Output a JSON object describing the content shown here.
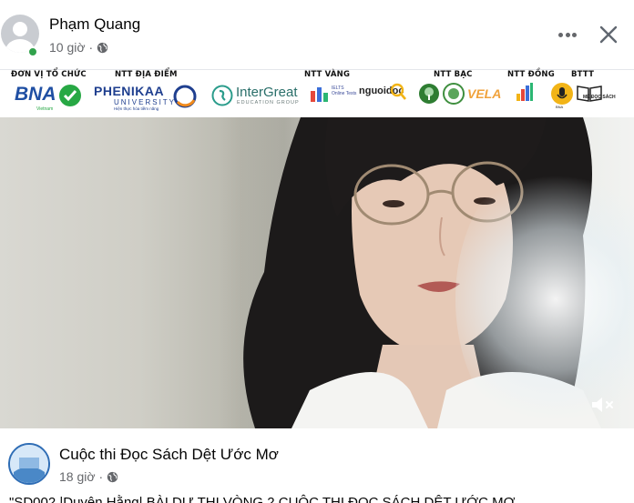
{
  "post": {
    "author": "Phạm Quang",
    "time": "10 giờ",
    "separator": "·",
    "privacy_icon": "globe-icon",
    "actions": {
      "more_icon": "more-horizontal-icon",
      "close_icon": "close-icon"
    }
  },
  "sponsors": {
    "organizer_label": "ĐƠN VỊ TỔ CHỨC",
    "venue_label": "NTT ĐỊA ĐIỂM",
    "gold_label": "NTT VÀNG",
    "silver_label": "NTT BẠC",
    "bronze_label": "NTT ĐỒNG",
    "media_label": "BTTT",
    "bna": {
      "name": "BNA",
      "sub": "Vietnam"
    },
    "phenikaa": {
      "name": "PHENIKAA",
      "sub": "UNIVERSITY",
      "tagline": "Hiện thực hóa tiềm năng"
    },
    "intergreat": {
      "name": "InterGreat",
      "sub": "EDUCATION GROUP"
    },
    "ielts": {
      "name": "IELTS Online Tests"
    },
    "nguoidoc": {
      "name": "nguoidoc"
    },
    "vela": {
      "name": "VELA"
    },
    "mds": {
      "name": "MÊ ĐỌC SÁCH"
    },
    "bna_small": "BNA"
  },
  "video": {
    "mute_icon": "speaker-muted-icon",
    "mute_symbol": "×"
  },
  "shared": {
    "page_name": "Cuộc thi Đọc Sách Dệt Ước Mơ",
    "time": "18 giờ",
    "separator": "·",
    "privacy_icon": "globe-icon",
    "text": "\"SD002 |Duyên Hằng| BÀI DỰ THI VÒNG 2 CUỘC THI ĐỌC SÁCH DỆT ƯỚC MƠ"
  },
  "colors": {
    "online": "#31a24c",
    "secondary_text": "#65676b",
    "bna_green": "#27a844",
    "phenikaa_blue": "#1f3f8f"
  }
}
